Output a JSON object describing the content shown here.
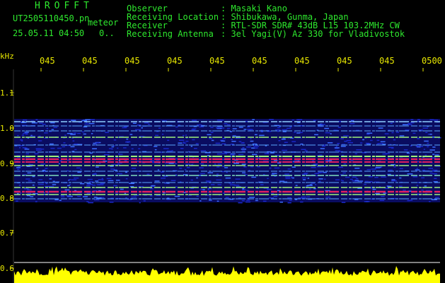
{
  "header": {
    "brand": "HROFFT",
    "filename": "UT2505110450.pn",
    "mode": "meteor",
    "datetime": "25.05.11 04:50",
    "counter": "0..",
    "info_labels": [
      "Observer",
      "Receiving Location",
      "Receiver",
      "Receiving Antenna"
    ],
    "info_values": [
      ": Masaki Kano",
      ": Shibukawa, Gunma, Japan",
      ": RTL-SDR SDR# 43dB L15 103.2MHz CW",
      ": 3el Yagi(V) Az 330 for Vladivostok"
    ]
  },
  "axis": {
    "y_unit": "kHz",
    "y_ticks": [
      "1.1",
      "1.0",
      "0.9",
      "0.8",
      "0.7",
      "0.6"
    ],
    "x_ticks": [
      "045",
      "045",
      "045",
      "045",
      "045",
      "045",
      "045",
      "045",
      "045",
      "0500"
    ]
  },
  "colors": {
    "text_green": "#2ee82e",
    "text_yellow": "#e8e800",
    "background": "#000000",
    "signal_blue": "#1a28c8",
    "signal_red": "#e02060",
    "noise_yellow": "#ffff00"
  }
}
